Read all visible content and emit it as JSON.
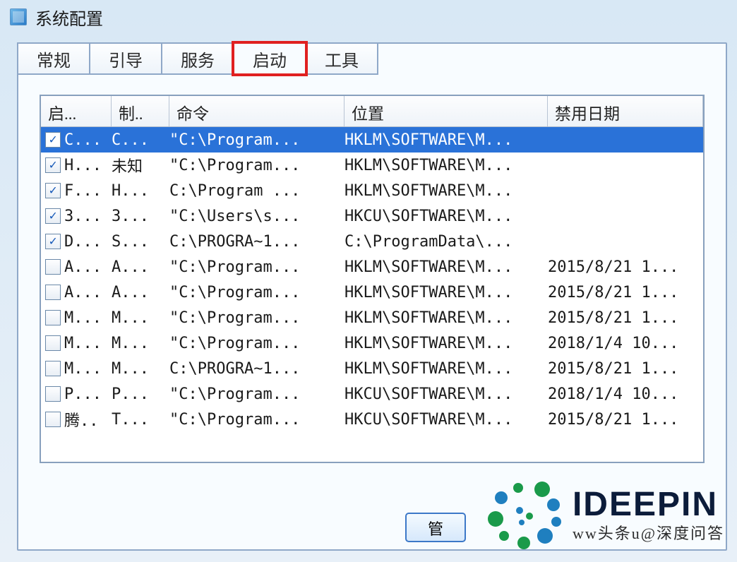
{
  "window": {
    "title": "系统配置"
  },
  "tabs": [
    {
      "label": "常规"
    },
    {
      "label": "引导"
    },
    {
      "label": "服务"
    },
    {
      "label": "启动",
      "active": true,
      "highlighted": true
    },
    {
      "label": "工具"
    }
  ],
  "columns": {
    "c0": "启...",
    "c1": "制..",
    "c2": "命令",
    "c3": "位置",
    "c4": "禁用日期"
  },
  "rows": [
    {
      "checked": true,
      "selected": true,
      "c0": "C...",
      "c1": "C...",
      "c2": "\"C:\\Program...",
      "c3": "HKLM\\SOFTWARE\\M...",
      "c4": ""
    },
    {
      "checked": true,
      "c0": "H...",
      "c1": "未知",
      "c2": "\"C:\\Program...",
      "c3": "HKLM\\SOFTWARE\\M...",
      "c4": ""
    },
    {
      "checked": true,
      "c0": "F...",
      "c1": "H...",
      "c2": "C:\\Program ...",
      "c3": "HKLM\\SOFTWARE\\M...",
      "c4": ""
    },
    {
      "checked": true,
      "c0": "3...",
      "c1": "3...",
      "c2": "\"C:\\Users\\s...",
      "c3": "HKCU\\SOFTWARE\\M...",
      "c4": ""
    },
    {
      "checked": true,
      "c0": "D...",
      "c1": "S...",
      "c2": "C:\\PROGRA~1...",
      "c3": "C:\\ProgramData\\...",
      "c4": ""
    },
    {
      "checked": false,
      "c0": "A...",
      "c1": "A...",
      "c2": "\"C:\\Program...",
      "c3": "HKLM\\SOFTWARE\\M...",
      "c4": "2015/8/21 1..."
    },
    {
      "checked": false,
      "c0": "A...",
      "c1": "A...",
      "c2": "\"C:\\Program...",
      "c3": "HKLM\\SOFTWARE\\M...",
      "c4": "2015/8/21 1..."
    },
    {
      "checked": false,
      "c0": "M...",
      "c1": "M...",
      "c2": "\"C:\\Program...",
      "c3": "HKLM\\SOFTWARE\\M...",
      "c4": "2015/8/21 1..."
    },
    {
      "checked": false,
      "c0": "M...",
      "c1": "M...",
      "c2": "\"C:\\Program...",
      "c3": "HKLM\\SOFTWARE\\M...",
      "c4": "2018/1/4 10..."
    },
    {
      "checked": false,
      "c0": "M...",
      "c1": "M...",
      "c2": "C:\\PROGRA~1...",
      "c3": "HKLM\\SOFTWARE\\M...",
      "c4": "2015/8/21 1..."
    },
    {
      "checked": false,
      "c0": "P...",
      "c1": "P...",
      "c2": "\"C:\\Program...",
      "c3": "HKCU\\SOFTWARE\\M...",
      "c4": "2018/1/4 10..."
    },
    {
      "checked": false,
      "c0": "腾..",
      "c1": "T...",
      "c2": "\"C:\\Program...",
      "c3": "HKCU\\SOFTWARE\\M...",
      "c4": "2015/8/21 1..."
    }
  ],
  "bottom_button": "管",
  "watermark": {
    "brand": "IDEEPIN",
    "sub": "ww头条u@深度问答"
  }
}
